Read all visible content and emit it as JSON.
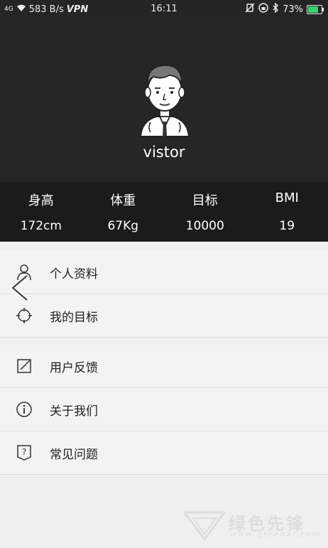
{
  "status_bar": {
    "signal": "4G",
    "speed": "583 B/s",
    "vpn": "VPN",
    "time": "16:11",
    "battery": "73%"
  },
  "profile": {
    "username": "vistor"
  },
  "stats": [
    {
      "label": "身高",
      "value": "172cm"
    },
    {
      "label": "体重",
      "value": "67Kg"
    },
    {
      "label": "目标",
      "value": "10000"
    },
    {
      "label": "BMI",
      "value": "19"
    }
  ],
  "menu": {
    "group1": [
      {
        "label": "个人资料",
        "icon": "person-icon"
      },
      {
        "label": "我的目标",
        "icon": "target-icon"
      }
    ],
    "group2": [
      {
        "label": "用户反馈",
        "icon": "edit-icon"
      },
      {
        "label": "关于我们",
        "icon": "info-icon"
      },
      {
        "label": "常见问题",
        "icon": "question-icon"
      }
    ]
  },
  "watermark": {
    "text": "绿色先锋",
    "url": "www.greenxf.com"
  },
  "colors": {
    "header_bg": "#262626",
    "stats_bg": "#1b1b1b",
    "page_bg": "#efefef",
    "battery_fill": "#3cd070"
  }
}
